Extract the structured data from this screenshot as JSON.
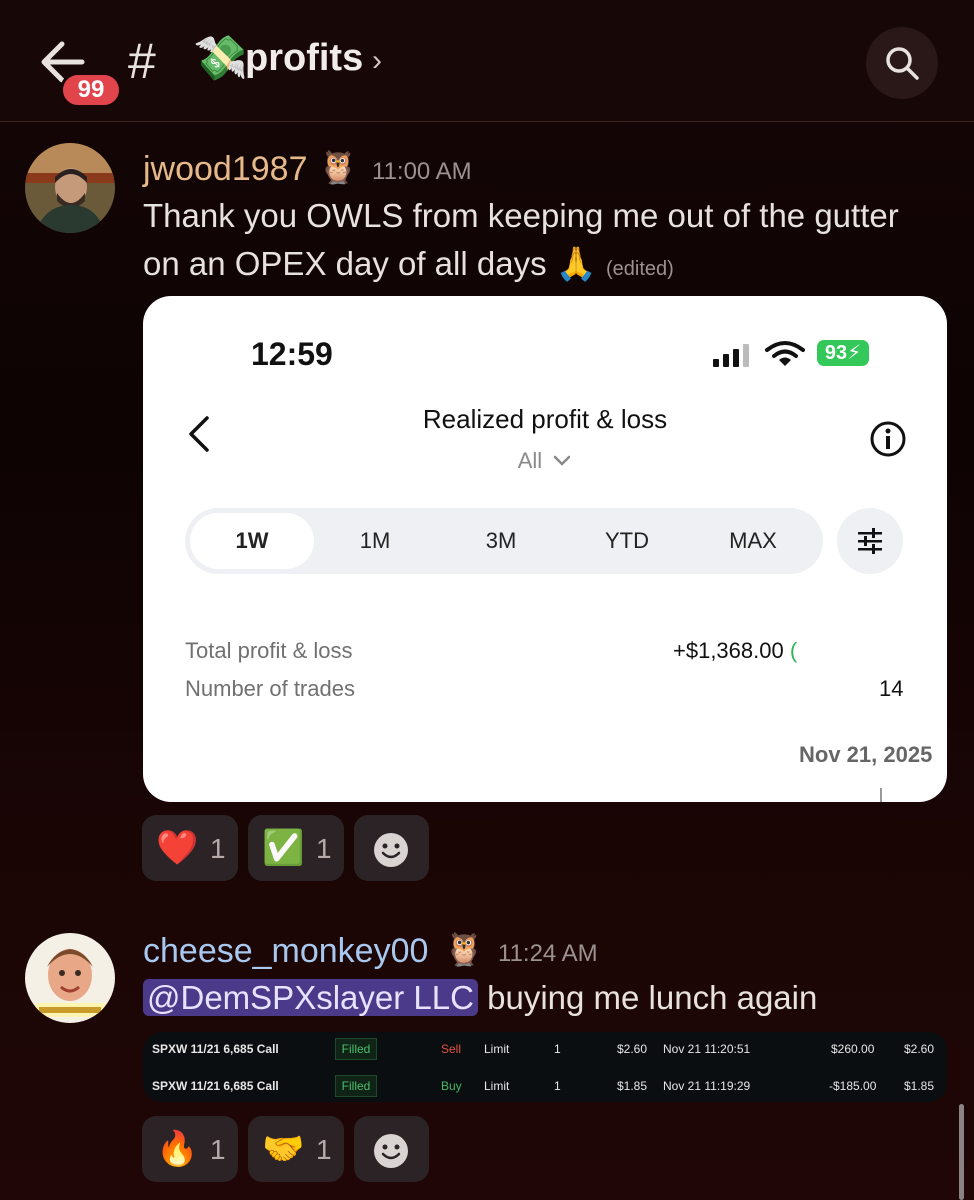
{
  "header": {
    "badge_count": "99",
    "channel_hash": "#",
    "channel_emoji": "💸",
    "channel_name": "profits",
    "channel_chevron": "›",
    "icons": [
      "back-arrow-icon",
      "search-icon"
    ]
  },
  "messages": [
    {
      "username": "jwood1987",
      "username_color": "#e6b98a",
      "badge_emoji": "🦉",
      "timestamp": "11:00 AM",
      "text_line1": "Thank you OWLS  from keeping me out of the gutter",
      "text_line2": "on an OPEX day of all days 🙏",
      "edited": "(edited)",
      "attachment": {
        "phone_time": "12:59",
        "battery": "93",
        "title": "Realized profit & loss",
        "filter": "All",
        "filter_chevron": "⌄",
        "ranges": [
          "1W",
          "1M",
          "3M",
          "YTD",
          "MAX"
        ],
        "active_range": "1W",
        "total_label": "Total profit & loss",
        "total_value": "+$1,368.00",
        "total_paren": "(",
        "trades_label": "Number of trades",
        "trades_value": "14",
        "date": "Nov 21, 2025"
      },
      "reactions": [
        {
          "emoji": "❤️",
          "count": "1"
        },
        {
          "emoji": "✅",
          "count": "1"
        }
      ]
    },
    {
      "username": "cheese_monkey00",
      "username_color": "#a9c8f0",
      "badge_emoji": "🦉",
      "timestamp": "11:24 AM",
      "mention": "@DemSPXslayer LLC",
      "text": " buying me lunch again",
      "trades": [
        {
          "symbol": "SPXW 11/21 6,685 Call",
          "status": "Filled",
          "side": "Sell",
          "type": "Limit",
          "qty": "1",
          "price": "$2.60",
          "time": "Nov 21 11:20:51",
          "amount": "$260.00",
          "fill": "$2.60"
        },
        {
          "symbol": "SPXW 11/21 6,685 Call",
          "status": "Filled",
          "side": "Buy",
          "type": "Limit",
          "qty": "1",
          "price": "$1.85",
          "time": "Nov 21 11:19:29",
          "amount": "-$185.00",
          "fill": "$1.85"
        }
      ],
      "reactions": [
        {
          "emoji": "🔥",
          "count": "1"
        },
        {
          "emoji": "🤝",
          "count": "1"
        }
      ]
    }
  ],
  "colors": {
    "badge": "#e2444c",
    "mention_bg": "#4b3a8a",
    "positive": "#34b35a",
    "sell": "#e0533f",
    "buy": "#44b764"
  }
}
